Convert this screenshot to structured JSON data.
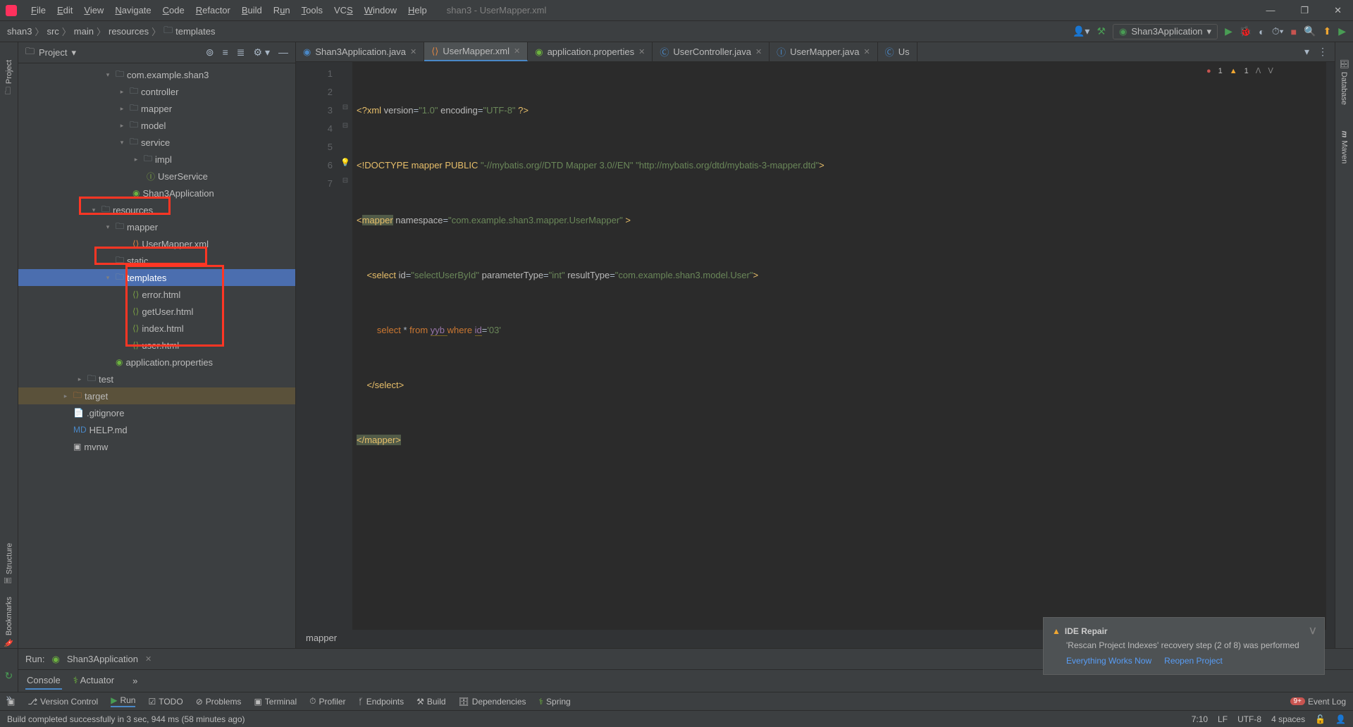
{
  "title": "shan3 - UserMapper.xml",
  "menu": [
    "File",
    "Edit",
    "View",
    "Navigate",
    "Code",
    "Refactor",
    "Build",
    "Run",
    "Tools",
    "VCS",
    "Window",
    "Help"
  ],
  "breadcrumb": [
    "shan3",
    "src",
    "main",
    "resources",
    "templates"
  ],
  "run_config": "Shan3Application",
  "project_label": "Project",
  "tree": {
    "pkg": "com.example.shan3",
    "controller": "controller",
    "mapper_pkg": "mapper",
    "model": "model",
    "service": "service",
    "impl": "impl",
    "userservice": "UserService",
    "shan3app": "Shan3Application",
    "resources": "resources",
    "mapper_dir": "mapper",
    "usermapper_xml": "UserMapper.xml",
    "static": "static",
    "templates": "templates",
    "error_html": "error.html",
    "getuser_html": "getUser.html",
    "index_html": "index.html",
    "user_html": "user.html",
    "app_props": "application.properties",
    "test": "test",
    "target": "target",
    "gitignore": ".gitignore",
    "help_md": "HELP.md",
    "mvnw": "mvnw"
  },
  "tabs": [
    {
      "label": "Shan3Application.java",
      "type": "java"
    },
    {
      "label": "UserMapper.xml",
      "type": "xml",
      "active": true
    },
    {
      "label": "application.properties",
      "type": "props"
    },
    {
      "label": "UserController.java",
      "type": "java"
    },
    {
      "label": "UserMapper.java",
      "type": "java"
    },
    {
      "label": "Us",
      "type": "java",
      "truncated": true
    }
  ],
  "code_lines": [
    "1",
    "2",
    "3",
    "4",
    "5",
    "6",
    "7"
  ],
  "code": {
    "l1_pre": "<?",
    "l1_tag": "xml ",
    "l1_attr1": "version",
    "l1_v1": "\"1.0\"",
    "l1_attr2": " encoding",
    "l1_v2": "\"UTF-8\"",
    "l1_end": " ?>",
    "l2_pre": "<!",
    "l2_doctype": "DOCTYPE mapper ",
    "l2_pub": "PUBLIC ",
    "l2_s1": "\"-//mybatis.org//DTD Mapper 3.0//EN\"",
    "l2_s2": " \"http://mybatis.org/dtd/mybatis-3-mapper.dtd\"",
    "l2_end": ">",
    "l3_open": "<",
    "l3_tag": "mapper",
    "l3_attr": " namespace",
    "l3_eq": "=",
    "l3_val": "\"com.example.shan3.mapper.UserMapper\"",
    "l3_end": " >",
    "l4_indent": "    ",
    "l4_open": "<",
    "l4_tag": "select",
    "l4_a1": " id",
    "l4_v1": "\"selectUserById\"",
    "l4_a2": " parameterType",
    "l4_v2": "\"int\"",
    "l4_a3": " resultType",
    "l4_v3": "\"com.example.shan3.model.User\"",
    "l4_end": ">",
    "l5_indent": "        ",
    "l5_kw1": "select",
    "l5_star": " * ",
    "l5_kw2": "from ",
    "l5_tbl": "yyb ",
    "l5_kw3": "where ",
    "l5_col": "id",
    "l5_eq": "=",
    "l5_val": "'03'",
    "l6_indent": "    ",
    "l6": "</select>",
    "l7": "</mapper>"
  },
  "editor_crumb": "mapper",
  "errors_count": "1",
  "warnings_count": "1",
  "run_panel": {
    "label": "Run:",
    "title": "Shan3Application",
    "tab1": "Console",
    "tab2": "Actuator"
  },
  "tools": {
    "vc": "Version Control",
    "run": "Run",
    "todo": "TODO",
    "problems": "Problems",
    "terminal": "Terminal",
    "profiler": "Profiler",
    "endpoints": "Endpoints",
    "build": "Build",
    "dependencies": "Dependencies",
    "spring": "Spring",
    "eventlog": "Event Log"
  },
  "status": {
    "msg": "Build completed successfully in 3 sec, 944 ms (58 minutes ago)",
    "pos": "7:10",
    "lf": "LF",
    "enc": "UTF-8",
    "indent": "4 spaces"
  },
  "notification": {
    "title": "IDE Repair",
    "body": "'Rescan Project Indexes' recovery step (2 of 8) was performed",
    "action1": "Everything Works Now",
    "action2": "Reopen Project"
  },
  "side_tabs": {
    "project": "Project",
    "structure": "Structure",
    "bookmarks": "Bookmarks",
    "database": "Database",
    "maven": "Maven"
  }
}
